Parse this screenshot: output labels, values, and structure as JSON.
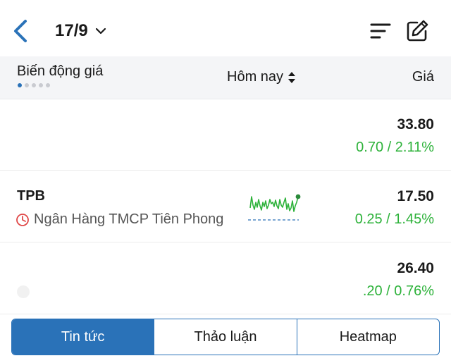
{
  "header": {
    "title": "17/9"
  },
  "columns": {
    "col1": "Biến động giá",
    "col2": "Hôm nay",
    "col3": "Giá",
    "page_dots": 5,
    "active_dot": 0
  },
  "rows": [
    {
      "symbol": "",
      "name": "",
      "price": "33.80",
      "change": "0.70 / 2.11%"
    },
    {
      "symbol": "TPB",
      "name": "Ngân Hàng TMCP Tiên Phong",
      "price": "17.50",
      "change": "0.25 / 1.45%"
    },
    {
      "symbol": "",
      "name": "",
      "price": "26.40",
      "change": ".20 / 0.76%"
    }
  ],
  "tabs": [
    {
      "label": "Tin tức",
      "active": true
    },
    {
      "label": "Thảo luận",
      "active": false
    },
    {
      "label": "Heatmap",
      "active": false
    }
  ],
  "colors": {
    "accent": "#2a72b8",
    "positive": "#2db23a",
    "warning": "#e04848"
  },
  "icons": {
    "back": "back-chevron-icon",
    "dropdown": "chevron-down-icon",
    "sort": "sort-icon",
    "edit": "edit-icon",
    "sort_updown": "sort-updown-icon",
    "clock": "clock-icon"
  }
}
